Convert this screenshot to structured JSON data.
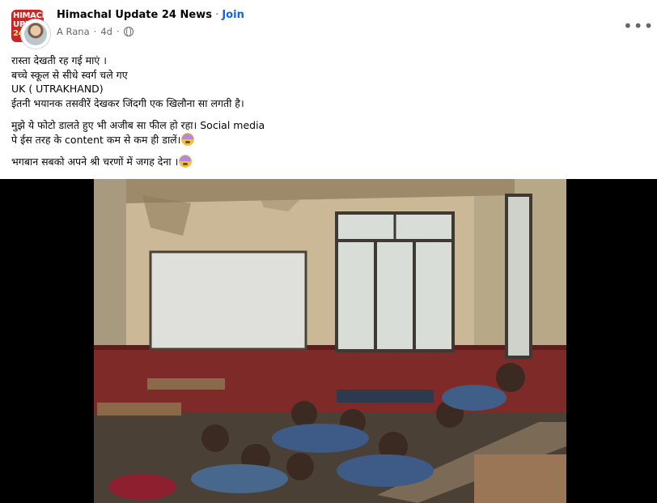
{
  "header": {
    "group_name": "Himachal Update 24 News",
    "separator": " · ",
    "join_label": "Join",
    "author": "A Rana",
    "meta_sep": "·",
    "time_ago": "4d",
    "more_label": "•••",
    "group_logo_lines": [
      "HIMACH",
      "UPDA",
      "24"
    ]
  },
  "post": {
    "lines": [
      "रास्ता देखती रह गई माएं ।",
      "बच्चे स्कूल से सीधे स्वर्ग चले गए",
      "UK ( UTRAKHAND)",
      "ईतनी भयानक तसवीरें देखकर जिंदगी एक खिलौना सा लगती है।"
    ],
    "para2_line1": "मुझे ये फोटो डालते हुए भी अजीब सा फील हो रहा। Social media",
    "para2_line2": "पे ईस तरह के content कम से कम ही डालें।",
    "para3": "भगबान सबको अपने श्री चरणों में जगह देना ।"
  },
  "icons": {
    "globe": "globe-icon",
    "more": "more-icon",
    "emoji": "sad-face-emoji"
  },
  "colors": {
    "link": "#0866ff",
    "meta": "#65676b",
    "logo_red": "#c62828"
  }
}
